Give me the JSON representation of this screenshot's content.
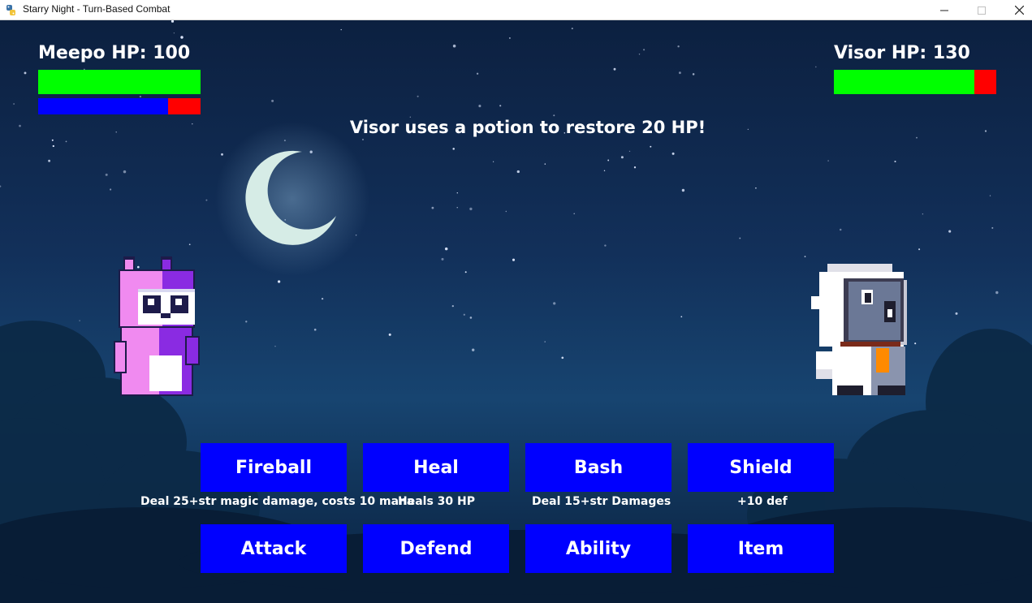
{
  "window": {
    "title": "Starry Night - Turn-Based Combat",
    "icon": "python-snake-icon",
    "controls": {
      "minimize": "—",
      "maximize": "☐",
      "close": "✕"
    }
  },
  "player": {
    "hp_label": "Meepo HP: 100",
    "hp_fraction": 1.0,
    "mana_fraction": 0.8,
    "hp_color": "#00ff00",
    "mana_color": "#0000ff",
    "missing_color": "#ff0000"
  },
  "enemy": {
    "hp_label": "Visor HP: 130",
    "hp_fraction": 0.865,
    "hp_color": "#00ff00",
    "missing_color": "#ff0000"
  },
  "battle_message": "Visor uses a potion to restore 20 HP!",
  "abilities": [
    {
      "label": "Fireball",
      "description": "Deal 25+str magic damage, costs 10 mana"
    },
    {
      "label": "Heal",
      "description": "Heals 30 HP"
    },
    {
      "label": "Bash",
      "description": "Deal 15+str Damages"
    },
    {
      "label": "Shield",
      "description": "+10 def"
    }
  ],
  "actions": [
    {
      "label": "Attack"
    },
    {
      "label": "Defend"
    },
    {
      "label": "Ability"
    },
    {
      "label": "Item"
    }
  ],
  "colors": {
    "button": "#0000ff",
    "button_text": "#ffffff"
  }
}
